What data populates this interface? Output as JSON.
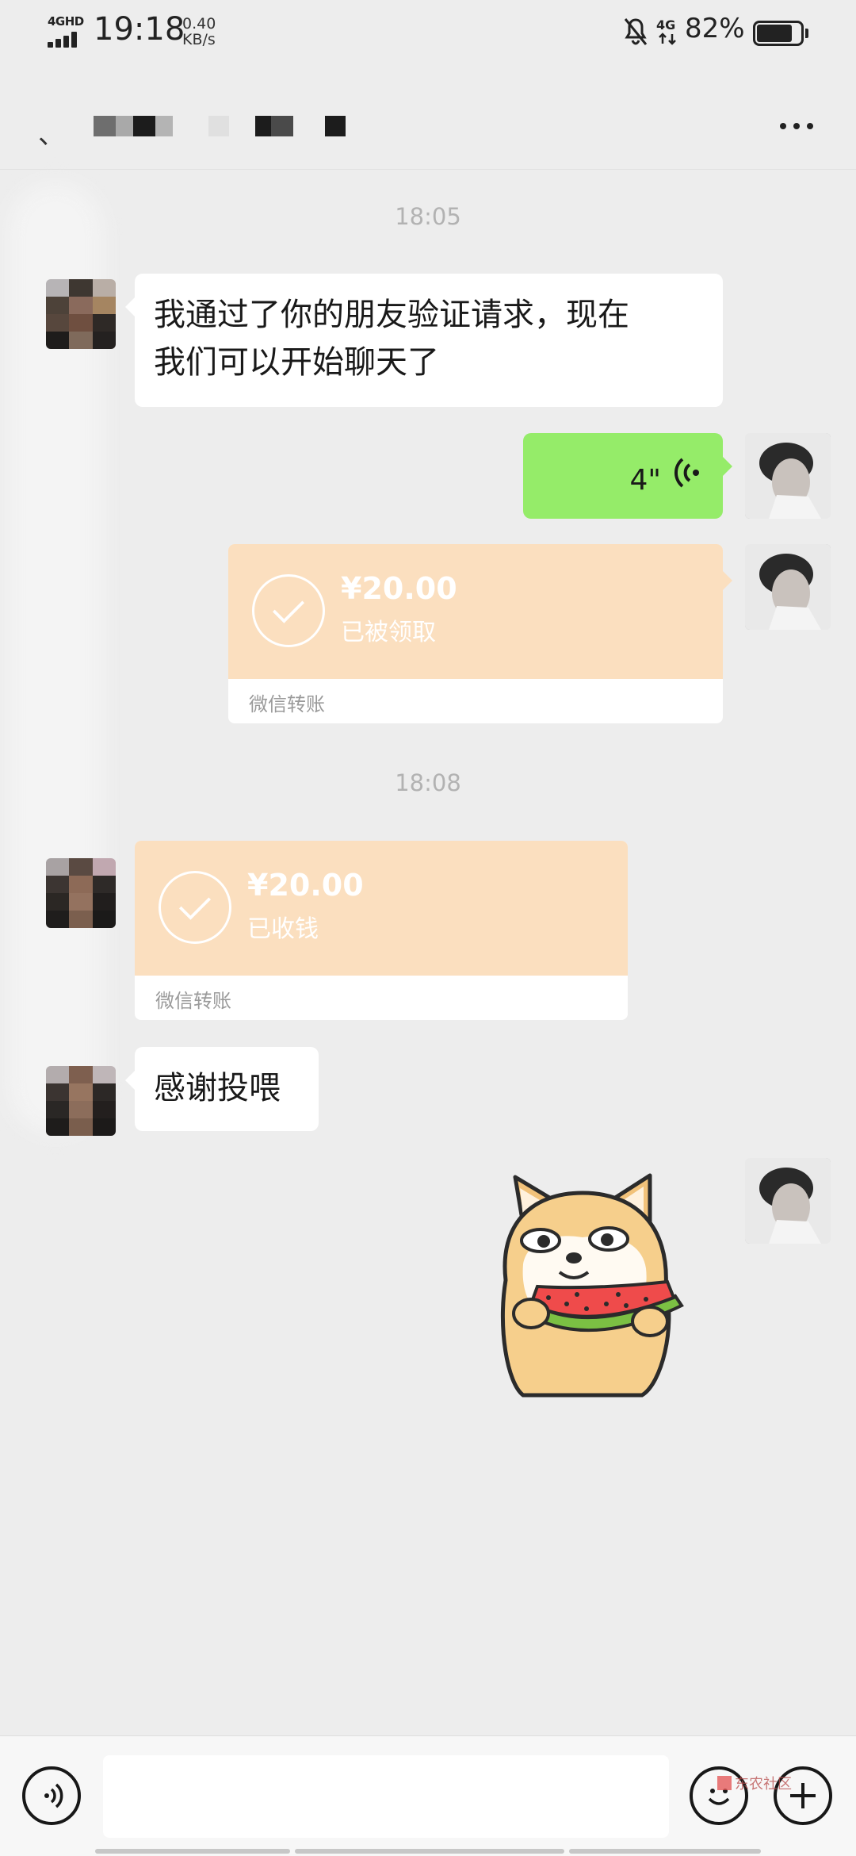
{
  "status_bar": {
    "network_tag": "4GHD",
    "time": "19:18",
    "speed_value": "0.40",
    "speed_unit": "KB/s",
    "mobile_tag": "4G",
    "battery_percent": "82%",
    "battery_level": 0.82,
    "icons": [
      "signal-icon",
      "mute-bell-icon",
      "battery-icon"
    ]
  },
  "header": {
    "back_mark": "、",
    "contact_name_obscured": true,
    "more_icon": "more-dots-icon"
  },
  "messages": [
    {
      "type": "timestamp",
      "text": "18:05"
    },
    {
      "type": "text",
      "side": "left",
      "text": "我通过了你的朋友验证请求，现在\n我们可以开始聊天了"
    },
    {
      "type": "voice",
      "side": "right",
      "duration": "4\""
    },
    {
      "type": "transfer",
      "side": "right",
      "amount": "¥20.00",
      "status": "已被领取",
      "label": "微信转账"
    },
    {
      "type": "timestamp",
      "text": "18:08"
    },
    {
      "type": "transfer",
      "side": "left",
      "amount": "¥20.00",
      "status": "已收钱",
      "label": "微信转账"
    },
    {
      "type": "text",
      "side": "left",
      "text": "感谢投喂"
    },
    {
      "type": "sticker",
      "side": "right",
      "sticker": "shiba-eating-watermelon"
    }
  ],
  "input_bar": {
    "voice_icon": "voice-input-icon",
    "emoji_icon": "emoji-icon",
    "plus_icon": "plus-icon",
    "watermark": "东农社区"
  },
  "colors": {
    "background": "#ededed",
    "bubble_self": "#95ec69",
    "bubble_other": "#ffffff",
    "transfer": "#fbdfbf"
  }
}
